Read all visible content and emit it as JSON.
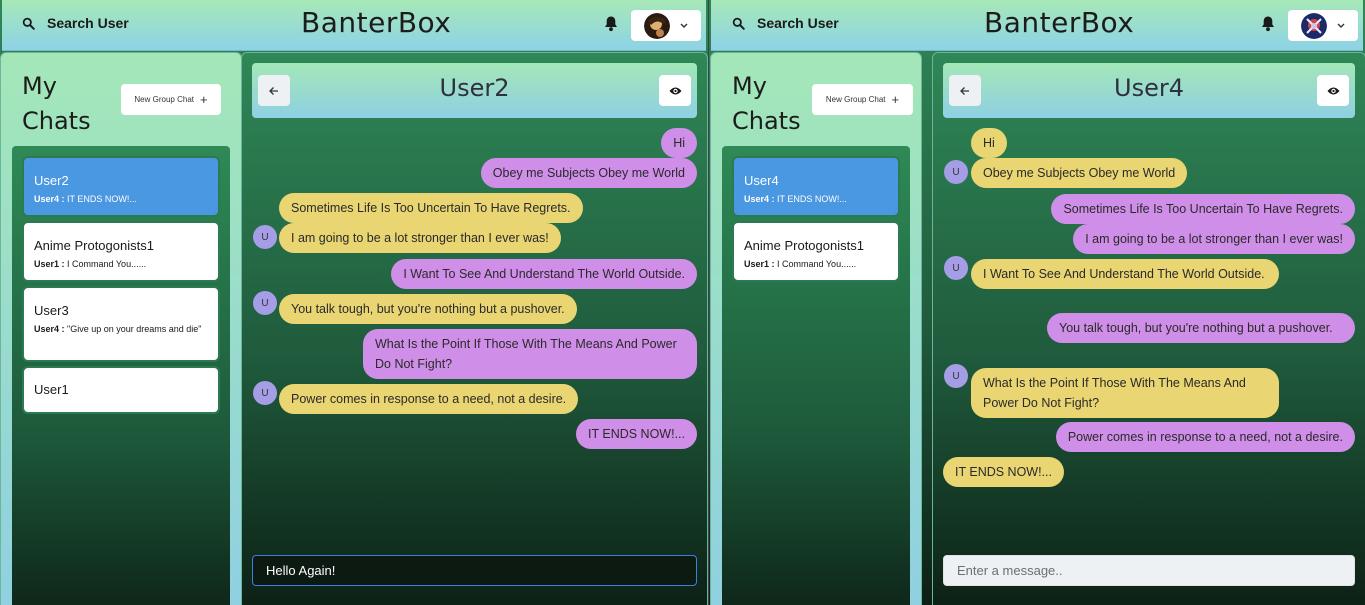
{
  "left": {
    "header": {
      "search_label": "Search User",
      "brand": "BanterBox"
    },
    "sidebar": {
      "title": "My Chats",
      "new_group_label": "New Group Chat",
      "chats": [
        {
          "name": "User2",
          "sender": "User4 :",
          "preview": "IT ENDS NOW!...",
          "active": true
        },
        {
          "name": "Anime Protogonists1",
          "sender": "User1 :",
          "preview": "I Command You......"
        },
        {
          "name": "User3",
          "sender": "User4 :",
          "preview": "\"Give up on your dreams and die\""
        },
        {
          "name": "User1"
        }
      ]
    },
    "chat": {
      "title": "User2",
      "messages": [
        {
          "text": "Hi",
          "mine": true
        },
        {
          "text": "Obey me Subjects Obey me World",
          "mine": true
        },
        {
          "text": "Sometimes Life Is Too Uncertain To Have Regrets.",
          "mine": false
        },
        {
          "text": "I am going to be a lot stronger than I ever was!",
          "mine": false,
          "avatar": "U"
        },
        {
          "text": "I Want To See And Understand The World Outside.",
          "mine": true
        },
        {
          "text": "You talk tough, but you're nothing but a pushover.",
          "mine": false,
          "avatar": "U"
        },
        {
          "text": "What Is the Point If Those With The Means And Power Do Not Fight?",
          "mine": true
        },
        {
          "text": "Power comes in response to a need, not a desire.",
          "mine": false,
          "avatar": "U"
        },
        {
          "text": "IT ENDS NOW!...",
          "mine": true
        }
      ],
      "input_value": "Hello Again!"
    }
  },
  "right": {
    "header": {
      "search_label": "Search User",
      "brand": "BanterBox"
    },
    "sidebar": {
      "title": "My Chats",
      "new_group_label": "New Group Chat",
      "chats": [
        {
          "name": "User4",
          "sender": "User4 :",
          "preview": "IT ENDS NOW!...",
          "active": true
        },
        {
          "name": "Anime Protogonists1",
          "sender": "User1 :",
          "preview": "I Command You......"
        }
      ]
    },
    "chat": {
      "title": "User4",
      "messages": [
        {
          "text": "Hi",
          "mine": false
        },
        {
          "text": "Obey me Subjects Obey me World",
          "mine": false,
          "avatar": "U"
        },
        {
          "text": "Sometimes Life Is Too Uncertain To Have Regrets.",
          "mine": true
        },
        {
          "text": "I am going to be a lot stronger than I ever was!",
          "mine": true
        },
        {
          "text": "I Want To See And Understand The World Outside.",
          "mine": false,
          "avatar": "U"
        },
        {
          "text": "You talk tough, but you're nothing but a pushover.",
          "mine": true
        },
        {
          "text": "What Is the Point If Those With The Means And Power Do Not Fight?",
          "mine": false,
          "avatar": "U"
        },
        {
          "text": "Power comes in response to a need, not a desire.",
          "mine": true
        },
        {
          "text": "IT ENDS NOW!...",
          "mine": false
        }
      ],
      "input_placeholder": "Enter a message.."
    }
  },
  "colors": {
    "mine_bubble": "#cf8ee8",
    "their_bubble": "#e9d672",
    "active_chat": "#4a97e2"
  },
  "icons": [
    "search-icon",
    "bell-icon",
    "chevron-down-icon",
    "plus-icon",
    "arrow-left-icon",
    "eye-icon"
  ]
}
